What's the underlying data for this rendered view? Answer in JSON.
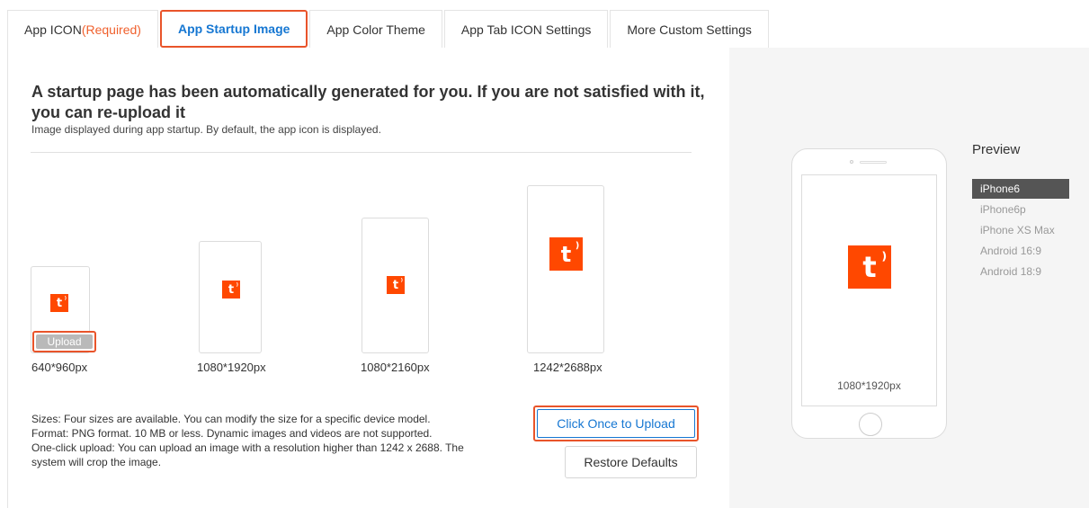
{
  "tabs": [
    {
      "label": "App ICON",
      "suffix": "(Required)"
    },
    {
      "label": "App Startup Image"
    },
    {
      "label": "App Color Theme"
    },
    {
      "label": "App Tab ICON Settings"
    },
    {
      "label": "More Custom Settings"
    }
  ],
  "main": {
    "title": "A startup page has been automatically generated for you. If you are not satisfied with it, you can re-upload it",
    "subtitle": "Image displayed during app startup. By default, the app icon is displayed.",
    "upload_label": "Upload",
    "logo_glyph": "t",
    "sizes": [
      "640*960px",
      "1080*1920px",
      "1080*2160px",
      "1242*2688px"
    ],
    "info": [
      "Sizes: Four sizes are available. You can modify the size for a specific device model.",
      "Format: PNG format. 10 MB or less. Dynamic images and videos are not supported.",
      "One-click upload: You can upload an image with a resolution higher than 1242 x 2688. The system will crop the image."
    ],
    "click_once_upload": "Click Once to Upload",
    "restore_defaults": "Restore Defaults"
  },
  "preview": {
    "title": "Preview",
    "phone_label": "1080*1920px",
    "devices": [
      "iPhone6",
      "iPhone6p",
      "iPhone XS Max",
      "Android 16:9",
      "Android 18:9"
    ],
    "selected_device": "iPhone6"
  },
  "colors": {
    "accent": "#1677d2",
    "brand": "#ff4800",
    "highlight": "#e9542a"
  }
}
